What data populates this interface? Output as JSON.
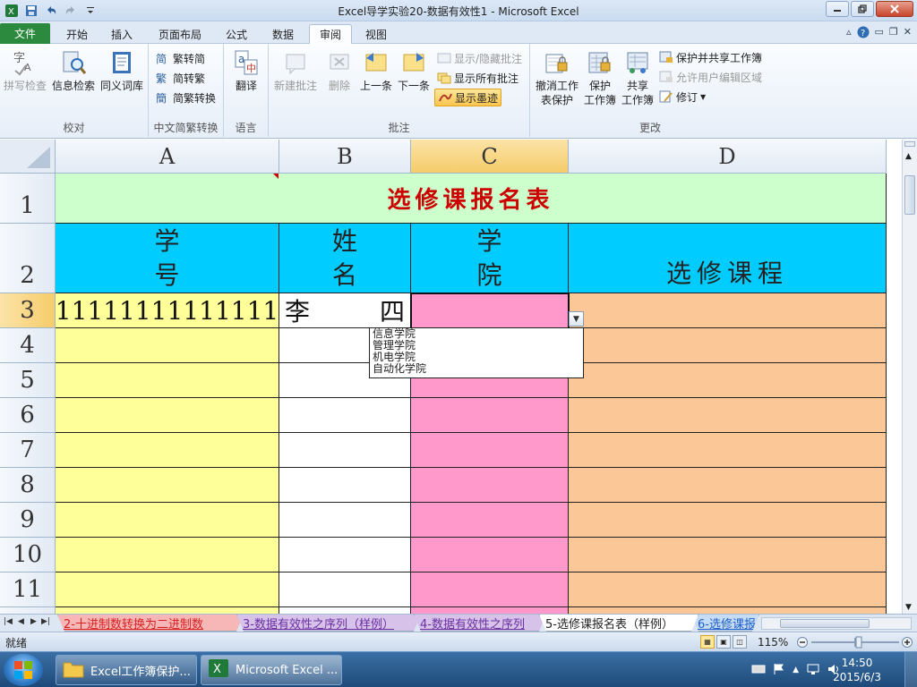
{
  "window": {
    "title": "Excel导学实验20-数据有效性1 - Microsoft Excel"
  },
  "ribbon_tabs": [
    "文件",
    "开始",
    "插入",
    "页面布局",
    "公式",
    "数据",
    "审阅",
    "视图"
  ],
  "active_tab": "审阅",
  "groups": {
    "proofing": {
      "label": "校对",
      "spell": "拼写检查",
      "research": "信息检索",
      "thesaurus": "同义词库"
    },
    "chinese": {
      "label": "中文简繁转换",
      "to_simplified": "繁转简",
      "to_traditional": "简转繁",
      "convert": "简繁转换"
    },
    "language": {
      "label": "语言",
      "translate": "翻译"
    },
    "comments": {
      "label": "批注",
      "new": "新建批注",
      "delete": "删除",
      "prev": "上一条",
      "next": "下一条",
      "show_hide": "显示/隐藏批注",
      "show_all": "显示所有批注",
      "show_ink": "显示墨迹"
    },
    "changes": {
      "label": "更改",
      "unprotect_1": "撤消工作",
      "unprotect_2": "表保护",
      "protect_wb_1": "保护",
      "protect_wb_2": "工作簿",
      "share_wb_1": "共享",
      "share_wb_2": "工作簿",
      "protect_share": "保护并共享工作簿",
      "allow_edit": "允许用户编辑区域",
      "track": "修订"
    }
  },
  "columns": [
    "A",
    "B",
    "C",
    "D"
  ],
  "rows": [
    "1",
    "2",
    "3",
    "4",
    "5",
    "6",
    "7",
    "8",
    "9",
    "10",
    "11"
  ],
  "sheet": {
    "title": "选修课报名表",
    "headers": {
      "a1": "学",
      "a2": "号",
      "b1": "姓",
      "b2": "名",
      "c1": "学",
      "c2": "院",
      "d": "选修课程"
    },
    "row3": {
      "id": "11111111111111",
      "name_first": "李",
      "name_last": "四"
    }
  },
  "dropdown_options": [
    "信息学院",
    "管理学院",
    "机电学院",
    "自动化学院"
  ],
  "sheet_tabs": [
    "2-十进制数转换为二进制数",
    "3-数据有效性之序列（样例）",
    "4-数据有效性之序列",
    "5-选修课报名表（样例）",
    "6-选修课报"
  ],
  "status": {
    "ready": "就绪",
    "zoom": "115%"
  },
  "taskbar": {
    "btn1": "Excel工作簿保护...",
    "btn2": "Microsoft Excel ...",
    "time": "14:50",
    "date": "2015/6/3"
  },
  "colors": {
    "title_bg": "#ccffcc",
    "title_text": "#cc0000",
    "header_bg": "#00ccff",
    "col_a": "#ffff99",
    "col_b": "#ffffff",
    "col_c": "#ff99cc",
    "col_d": "#fcc797",
    "file_tab": "#2c8a3e"
  },
  "icons": [
    "save-icon",
    "undo-icon",
    "redo-icon",
    "customize-qat-icon",
    "help-icon",
    "minimize-icon",
    "restore-icon",
    "close-icon",
    "windows-start-icon",
    "folder-icon",
    "excel-icon",
    "keyboard-icon",
    "flag-icon",
    "network-icon",
    "volume-icon"
  ]
}
